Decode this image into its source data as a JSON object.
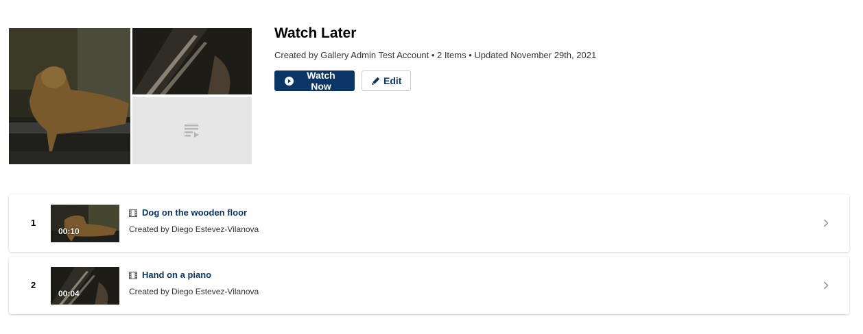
{
  "playlist": {
    "title": "Watch Later",
    "meta": "Created by Gallery Admin Test Account • 2 Items • Updated November 29th, 2021",
    "watch_now_label": "Watch Now",
    "edit_label": "Edit"
  },
  "items": [
    {
      "index": "1",
      "duration": "00:10",
      "title": "Dog on the wooden floor",
      "created_by": "Created by Diego Estevez-Vilanova"
    },
    {
      "index": "2",
      "duration": "00:04",
      "title": "Hand on a piano",
      "created_by": "Created by Diego Estevez-Vilanova"
    }
  ],
  "icons": {
    "play": "play-circle-icon",
    "edit": "pencil-icon",
    "placeholder": "playlist-icon",
    "media_type": "film-icon",
    "row_action": "chevron-right-icon"
  },
  "colors": {
    "brand": "#0a3566",
    "placeholder_tile": "#e6e6e6"
  }
}
